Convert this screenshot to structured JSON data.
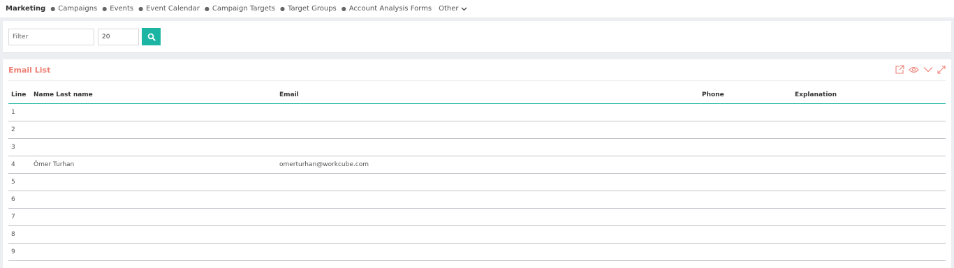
{
  "nav": {
    "brand": "Marketing",
    "items": [
      {
        "label": "Campaigns"
      },
      {
        "label": "Events"
      },
      {
        "label": "Event Calendar"
      },
      {
        "label": "Campaign Targets"
      },
      {
        "label": "Target Groups"
      },
      {
        "label": "Account Analysis Forms"
      }
    ],
    "other_label": "Other",
    "other_icon": "chevron-down-icon"
  },
  "filter": {
    "placeholder": "Filter",
    "value": "",
    "page_size": "20",
    "search_icon": "search-icon",
    "button_color": "#1cb5a4"
  },
  "panel": {
    "title": "Email List",
    "title_color": "#ee8076",
    "tools": [
      "export-icon",
      "eye-icon",
      "collapse-chevron-icon",
      "expand-icon"
    ]
  },
  "table": {
    "headers": {
      "line": "Line",
      "name": "Name Last name",
      "email": "Email",
      "phone": "Phone",
      "explanation": "Explanation"
    },
    "rows": [
      {
        "line": "1",
        "name": "",
        "email": "",
        "phone": "",
        "explanation": ""
      },
      {
        "line": "2",
        "name": "",
        "email": "",
        "phone": "",
        "explanation": ""
      },
      {
        "line": "3",
        "name": "",
        "email": "",
        "phone": "",
        "explanation": ""
      },
      {
        "line": "4",
        "name": "Ömer Turhan",
        "email": "omerturhan@workcube.com",
        "phone": "",
        "explanation": ""
      },
      {
        "line": "5",
        "name": "",
        "email": "",
        "phone": "",
        "explanation": ""
      },
      {
        "line": "6",
        "name": "",
        "email": "",
        "phone": "",
        "explanation": ""
      },
      {
        "line": "7",
        "name": "",
        "email": "",
        "phone": "",
        "explanation": ""
      },
      {
        "line": "8",
        "name": "",
        "email": "",
        "phone": "",
        "explanation": ""
      },
      {
        "line": "9",
        "name": "",
        "email": "",
        "phone": "",
        "explanation": ""
      }
    ]
  }
}
